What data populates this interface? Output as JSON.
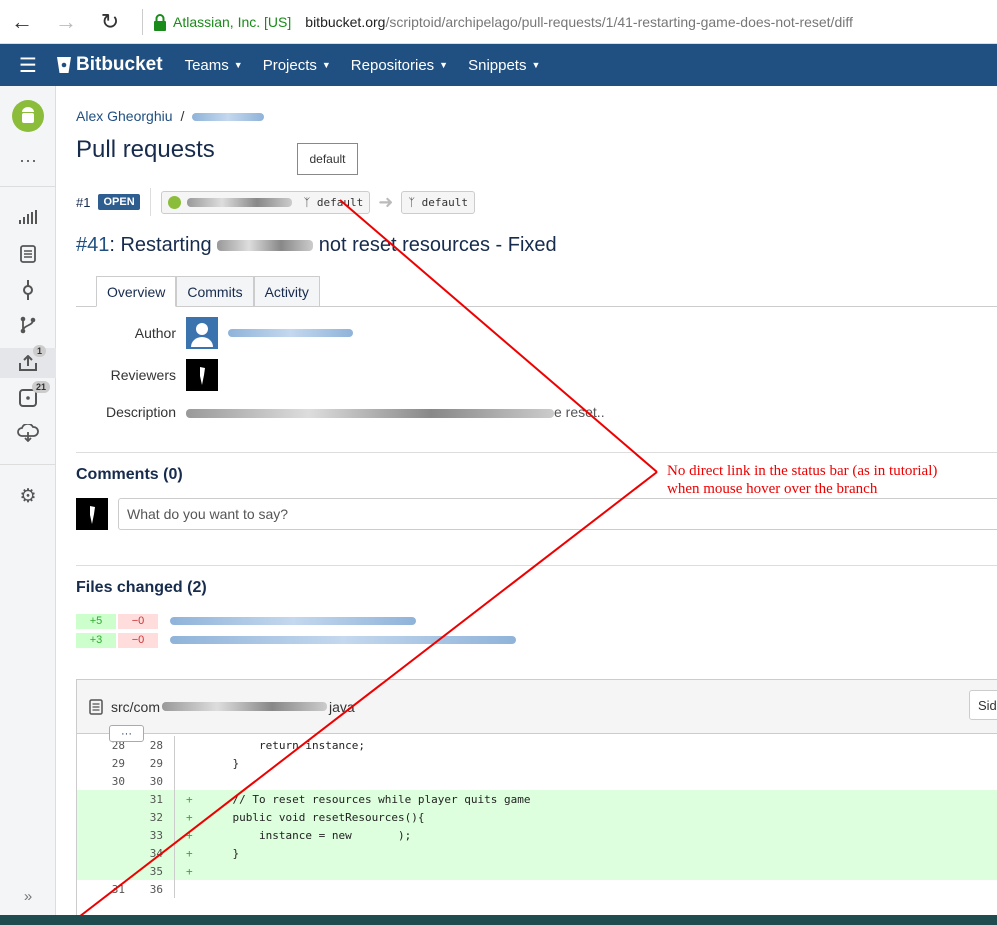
{
  "browser": {
    "cert": "Atlassian, Inc. [US]",
    "url_domain": "bitbucket.org",
    "url_path": "/scriptoid/archipelago/pull-requests/1/41-restarting-game-does-not-reset/diff"
  },
  "header": {
    "logo": "Bitbucket",
    "menu": [
      "Teams",
      "Projects",
      "Repositories",
      "Snippets"
    ]
  },
  "sidebar": {
    "pr_badge": "1",
    "issues_badge": "21"
  },
  "breadcrumb": {
    "owner": "Alex Gheorghiu"
  },
  "page": {
    "title": "Pull requests",
    "tooltip": "default"
  },
  "pr": {
    "number": "#1",
    "status": "OPEN",
    "source_branch": "default",
    "dest_branch": "default",
    "title_num": "#41",
    "title_a": ": Restarting",
    "title_b": "not reset resources - Fixed"
  },
  "tabs": [
    "Overview",
    "Commits",
    "Activity"
  ],
  "fields": {
    "author": "Author",
    "reviewers": "Reviewers",
    "description": "Description",
    "desc_tail": "e reset.."
  },
  "comments": {
    "title": "Comments (0)",
    "placeholder": "What do you want to say?"
  },
  "files": {
    "title": "Files changed (2)",
    "rows": [
      {
        "add": "+5",
        "del": "−0"
      },
      {
        "add": "+3",
        "del": "−0"
      }
    ]
  },
  "diff": {
    "path_prefix": "src/com",
    "path_suffix": "java",
    "side_btn": "Sid",
    "expand": "···",
    "lines": [
      {
        "old": "28",
        "new": "28",
        "mark": "",
        "text": "        return instance;",
        "added": false
      },
      {
        "old": "29",
        "new": "29",
        "mark": "",
        "text": "    }",
        "added": false
      },
      {
        "old": "30",
        "new": "30",
        "mark": "",
        "text": "",
        "added": false
      },
      {
        "old": "",
        "new": "31",
        "mark": "+",
        "text": "    // To reset resources while player quits game",
        "added": true
      },
      {
        "old": "",
        "new": "32",
        "mark": "+",
        "text": "    public void resetResources(){",
        "added": true
      },
      {
        "old": "",
        "new": "33",
        "mark": "+",
        "text": "        instance = new       );",
        "added": true
      },
      {
        "old": "",
        "new": "34",
        "mark": "+",
        "text": "    }",
        "added": true
      },
      {
        "old": "",
        "new": "35",
        "mark": "+",
        "text": "",
        "added": true
      },
      {
        "old": "31",
        "new": "36",
        "mark": "",
        "text": "",
        "added": false
      }
    ]
  },
  "annotation": {
    "line1": "No direct link in the status bar (as in tutorial)",
    "line2": "when mouse hover over the branch",
    "color": "#e00000"
  }
}
